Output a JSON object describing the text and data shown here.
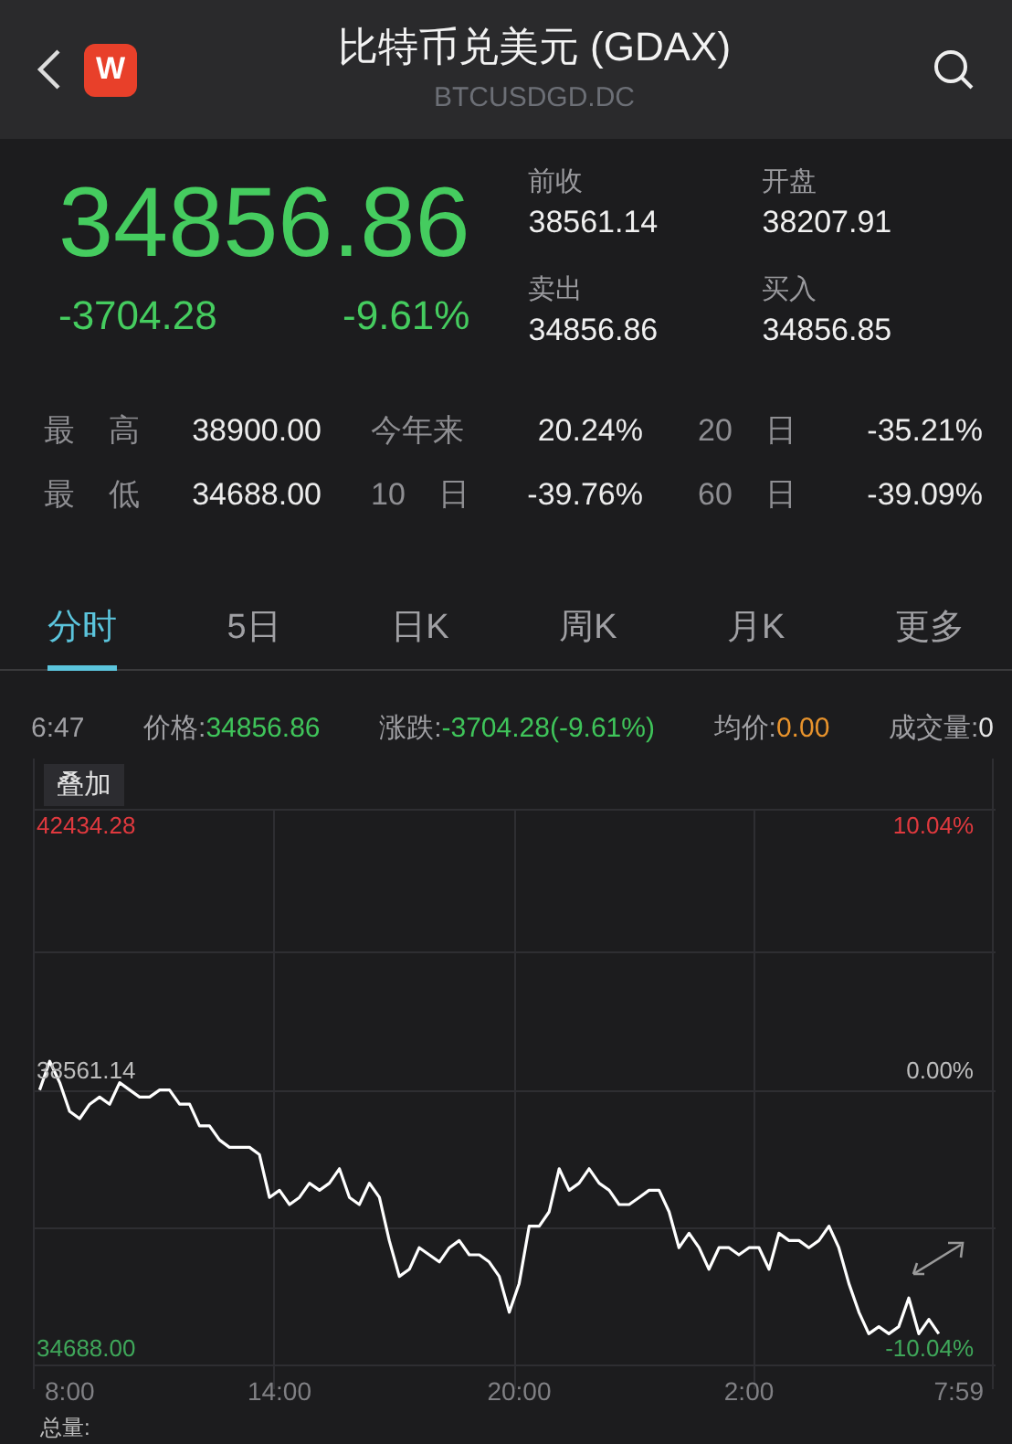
{
  "header": {
    "logo": "W",
    "title": "比特币兑美元 (GDAX)",
    "subtitle": "BTCUSDGD.DC"
  },
  "quote": {
    "price": "34856.86",
    "change": "-3704.28",
    "change_pct": "-9.61%",
    "fields": [
      {
        "label": "前收",
        "value": "38561.14"
      },
      {
        "label": "开盘",
        "value": "38207.91"
      },
      {
        "label": "卖出",
        "value": "34856.86"
      },
      {
        "label": "买入",
        "value": "34856.85"
      }
    ]
  },
  "stats": [
    {
      "label": "最 高",
      "value": "38900.00"
    },
    {
      "label": "今年来",
      "value": "20.24%"
    },
    {
      "label": "20 日",
      "value": "-35.21%"
    },
    {
      "label": "最 低",
      "value": "34688.00"
    },
    {
      "label": "10 日",
      "value": "-39.76%"
    },
    {
      "label": "60 日",
      "value": "-39.09%"
    }
  ],
  "tabs": [
    {
      "label": "分时",
      "selected": true
    },
    {
      "label": "5日",
      "selected": false
    },
    {
      "label": "日K",
      "selected": false
    },
    {
      "label": "周K",
      "selected": false
    },
    {
      "label": "月K",
      "selected": false
    },
    {
      "label": "更多",
      "selected": false
    }
  ],
  "info_bar": {
    "time": "6:47",
    "items": [
      {
        "label": "价格:",
        "value": "34856.86",
        "color": "#3fc45a"
      },
      {
        "label": "涨跌:",
        "value": "-3704.28(-9.61%)",
        "color": "#3fc45a"
      },
      {
        "label": "均价:",
        "value": "0.00",
        "color": "#e8932c"
      },
      {
        "label": "成交量:",
        "value": "0",
        "color": "#e6e6e6"
      }
    ]
  },
  "chart": {
    "overlay_button": "叠加",
    "right_labels": [
      {
        "text": "10.04%",
        "color": "#e0393e"
      },
      {
        "text": "0.00%",
        "color": "#bdbdbd"
      },
      {
        "text": "-10.04%",
        "color": "#3fa75a"
      }
    ],
    "max_label": {
      "text": "42434.28",
      "color": "#e0393e"
    },
    "chart_data": {
      "type": "line",
      "ylim": [
        34459,
        42205
      ],
      "categories": [
        null,
        null,
        null,
        "8:00",
        null,
        null,
        null,
        null,
        null,
        null,
        null,
        null,
        null,
        null,
        null,
        null,
        null,
        null,
        null,
        null,
        null,
        null,
        null,
        null,
        "14:00",
        null,
        null,
        null,
        null,
        null,
        null,
        null,
        null,
        null,
        null,
        null,
        null,
        null,
        null,
        null,
        null,
        null,
        null,
        null,
        null,
        null,
        null,
        null,
        "20:00",
        null,
        null,
        null,
        null,
        null,
        null,
        null,
        null,
        null,
        null,
        null,
        null,
        null,
        null,
        null,
        null,
        null,
        null,
        null,
        null,
        null,
        null,
        "2:00",
        null,
        null,
        null,
        null,
        null,
        null,
        null,
        null,
        null,
        null,
        null,
        null,
        null,
        null,
        null,
        null,
        null,
        null,
        null,
        null,
        "7:59",
        null,
        null,
        null
      ],
      "yticks": [
        {
          "value": 38561.14,
          "label": "38561.14"
        },
        {
          "value": 34688,
          "label": "34688.00"
        }
      ],
      "series": [
        {
          "color": "#ffffff",
          "values": [
            38300,
            38700,
            38400,
            38000,
            37900,
            38100,
            38200,
            38100,
            38400,
            38300,
            38200,
            38200,
            38300,
            38300,
            38100,
            38100,
            37800,
            37800,
            37600,
            37500,
            37500,
            37500,
            37400,
            36800,
            36900,
            36700,
            36800,
            37000,
            36900,
            37000,
            37200,
            36800,
            36700,
            37000,
            36800,
            36200,
            35700,
            35800,
            36100,
            36000,
            35900,
            36100,
            36200,
            36000,
            36000,
            35900,
            35700,
            35200,
            35600,
            36400,
            36400,
            36600,
            37200,
            36900,
            37000,
            37200,
            37000,
            36900,
            36700,
            36700,
            36800,
            36900,
            36900,
            36600,
            36100,
            36300,
            36100,
            35800,
            36100,
            36100,
            36000,
            36100,
            36100,
            35800,
            36300,
            36200,
            36200,
            36100,
            36200,
            36400,
            36100,
            35600,
            35200,
            34900,
            35000,
            34900,
            35000,
            35400,
            34900,
            35100,
            34900,
            null,
            null,
            null,
            null,
            null
          ]
        }
      ]
    },
    "footer_label": "总量:"
  }
}
